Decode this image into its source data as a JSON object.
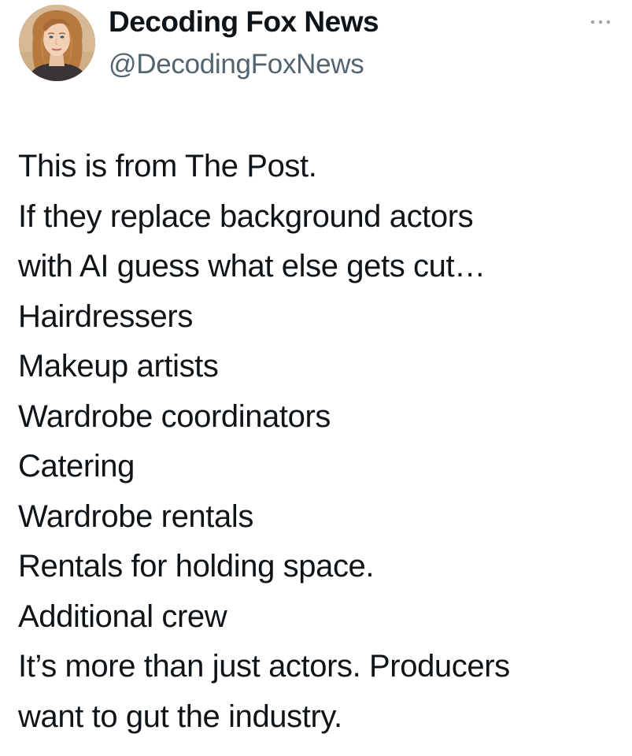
{
  "author": {
    "display_name": "Decoding Fox News",
    "handle": "@DecodingFoxNews",
    "avatar_icon": "profile-photo"
  },
  "menu": {
    "icon": "more-options-icon"
  },
  "tweet": {
    "lines": [
      "This is from The Post.",
      "If they replace background actors",
      "with AI guess what else gets cut…",
      "Hairdressers",
      "Makeup artists",
      "Wardrobe coordinators",
      "Catering",
      "Wardrobe rentals",
      "Rentals for holding space.",
      "Additional crew",
      "It’s more than just actors. Producers",
      "want to gut the industry."
    ]
  },
  "colors": {
    "text": "#0f1419",
    "secondary_text": "#536471",
    "background": "#ffffff"
  }
}
